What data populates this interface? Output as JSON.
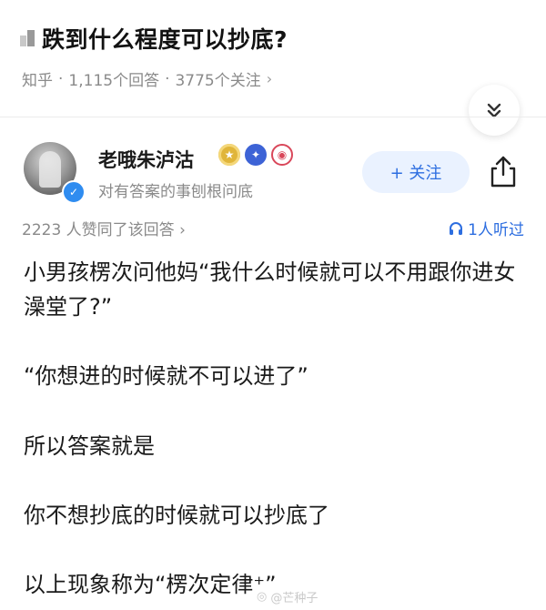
{
  "question": {
    "title": "跌到什么程度可以抄底?",
    "source": "知乎",
    "answers_count": "1,115个回答",
    "followers_count": "3775个关注",
    "sep": "·",
    "chevron": "›"
  },
  "expand_button": {
    "icon": "double-chevron-down-icon",
    "glyph": "»"
  },
  "author": {
    "name": "老哦朱泸沽",
    "description": "对有答案的事刨根问底",
    "follow_label": "+ 关注",
    "badges": [
      "gold-badge",
      "blue-badge",
      "red-badge"
    ]
  },
  "stats": {
    "likes": "2223 人赞同了该回答 ›",
    "listeners": "1人听过",
    "listen_icon": "headphones-icon"
  },
  "answer": {
    "p1": "小男孩楞次问他妈“我什么时候就可以不用跟你进女澡堂了?”",
    "p2": "“你想进的时候就不可以进了”",
    "p3": "所以答案就是",
    "p4": "你不想抄底的时候就可以抄底了",
    "p5_prefix": "以上现象称为",
    "p5_link": "“楞次定律⁺”"
  },
  "watermark": {
    "text": "@芒种子"
  },
  "colors": {
    "accent_blue": "#2d6ee0",
    "follow_bg": "#eaf2ff",
    "gray_text": "#8a8a8a"
  }
}
